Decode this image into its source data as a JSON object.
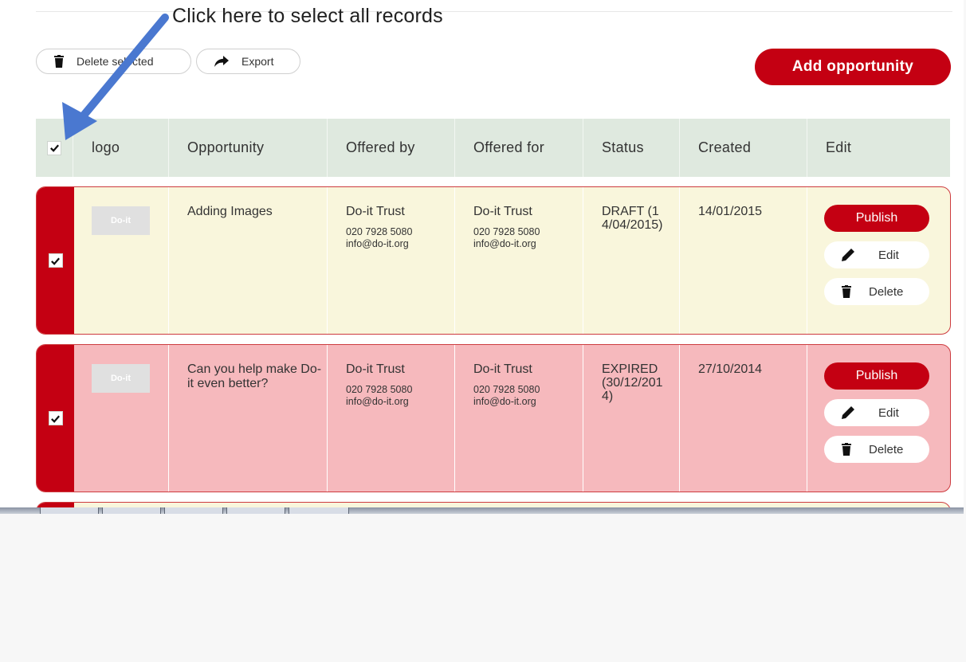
{
  "annotation": {
    "text": "Click here to select all records",
    "arrow_color": "#4a78d0"
  },
  "toolbar": {
    "delete_selected_label": "Delete selected",
    "export_label": "Export",
    "add_opportunity_label": "Add opportunity",
    "accent_color": "#c40012"
  },
  "table": {
    "headers": {
      "logo": "logo",
      "opportunity": "Opportunity",
      "offered_by": "Offered by",
      "offered_for": "Offered for",
      "status": "Status",
      "created": "Created",
      "edit": "Edit"
    },
    "select_all_checked": true,
    "rows": [
      {
        "checked": true,
        "logo_text": "Do-it",
        "opportunity": "Adding Images",
        "offered_by": {
          "name": "Do-it Trust",
          "phone": "020 7928 5080",
          "email": "info@do-it.org"
        },
        "offered_for": {
          "name": "Do-it Trust",
          "phone": "020 7928 5080",
          "email": "info@do-it.org"
        },
        "status": "DRAFT (14/04/2015)",
        "created": "14/01/2015",
        "actions": {
          "publish": "Publish",
          "edit": "Edit",
          "delete": "Delete"
        },
        "row_color": "#f9f6dc"
      },
      {
        "checked": true,
        "logo_text": "Do-it",
        "opportunity": "Can you help make Do-it even better?",
        "offered_by": {
          "name": "Do-it Trust",
          "phone": "020 7928 5080",
          "email": "info@do-it.org"
        },
        "offered_for": {
          "name": "Do-it Trust",
          "phone": "020 7928 5080",
          "email": "info@do-it.org"
        },
        "status": "EXPIRED (30/12/2014)",
        "created": "27/10/2014",
        "actions": {
          "publish": "Publish",
          "edit": "Edit",
          "delete": "Delete"
        },
        "row_color": "#f6b9bd"
      }
    ]
  }
}
